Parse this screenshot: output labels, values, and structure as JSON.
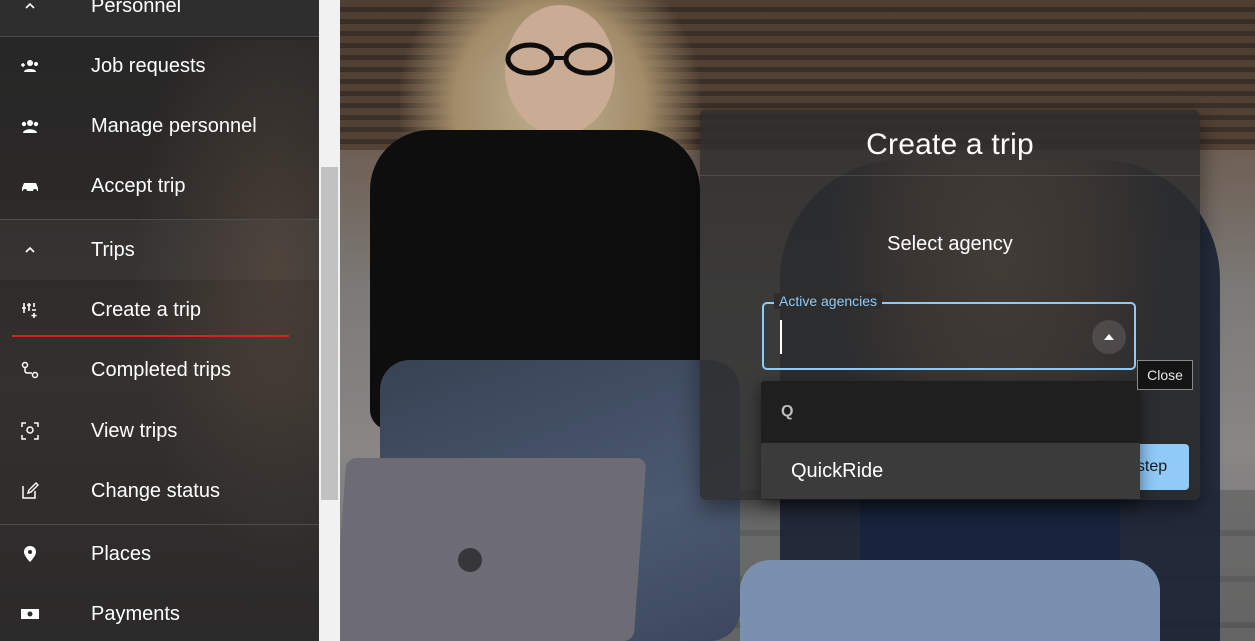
{
  "sidebar": {
    "sections": [
      {
        "label": "Personnel",
        "expanded": true
      },
      {
        "label": "Trips",
        "expanded": true
      }
    ],
    "personnel_items": [
      {
        "label": "Job requests",
        "icon": "group-add-icon"
      },
      {
        "label": "Manage personnel",
        "icon": "people-icon"
      },
      {
        "label": "Accept trip",
        "icon": "car-icon"
      }
    ],
    "trip_items": [
      {
        "label": "Create a trip",
        "icon": "tune-add-icon",
        "active": true
      },
      {
        "label": "Completed trips",
        "icon": "route-icon"
      },
      {
        "label": "View trips",
        "icon": "scan-person-icon"
      },
      {
        "label": "Change status",
        "icon": "edit-icon"
      }
    ],
    "bottom_items": [
      {
        "label": "Places",
        "icon": "location-pin-icon"
      },
      {
        "label": "Payments",
        "icon": "cash-icon"
      }
    ]
  },
  "dialog": {
    "title": "Create a trip",
    "subtitle": "Select agency",
    "field": {
      "label": "Active agencies",
      "value": ""
    },
    "next_button_partial": "step"
  },
  "dropdown": {
    "group_header": "Q",
    "options": [
      "QuickRide"
    ]
  },
  "tooltip": {
    "text": "Close"
  },
  "colors": {
    "accent_blue": "#90caf9",
    "active_underline": "#e11d1d",
    "sidebar_bg": "#2a2a2a",
    "dialog_bg": "#2d2d2d"
  }
}
